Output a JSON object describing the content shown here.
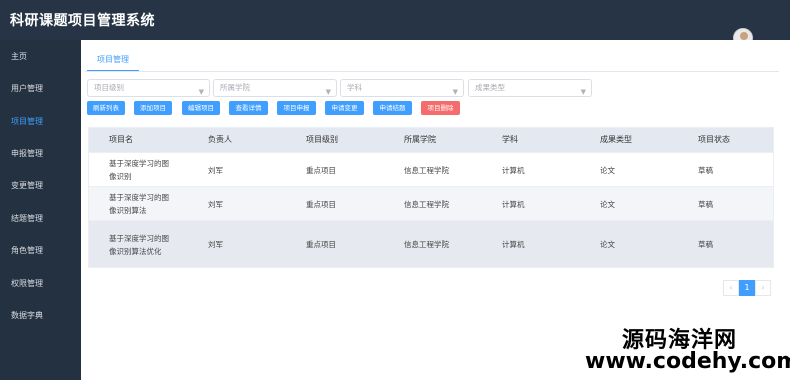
{
  "app": {
    "title": "科研课题项目管理系统"
  },
  "sidebar": {
    "items": [
      {
        "label": "主页",
        "active": false
      },
      {
        "label": "用户管理",
        "active": false
      },
      {
        "label": "项目管理",
        "active": true
      },
      {
        "label": "申报管理",
        "active": false
      },
      {
        "label": "变更管理",
        "active": false
      },
      {
        "label": "结题管理",
        "active": false
      },
      {
        "label": "角色管理",
        "active": false
      },
      {
        "label": "权限管理",
        "active": false
      },
      {
        "label": "数据字典",
        "active": false
      }
    ]
  },
  "tabs": [
    {
      "label": "项目管理"
    }
  ],
  "filters": {
    "level": {
      "placeholder": "项目级别"
    },
    "college": {
      "placeholder": "所属学院"
    },
    "subject": {
      "placeholder": "学科"
    },
    "result_type": {
      "placeholder": "成果类型"
    }
  },
  "toolbar": {
    "refresh": "刷新列表",
    "add": "添加项目",
    "edit": "编辑项目",
    "details": "查看详情",
    "declare": "项目申报",
    "change": "申请变更",
    "conclude": "申请结题",
    "delete": "项目删除"
  },
  "table": {
    "headers": [
      "项目名",
      "负责人",
      "项目级别",
      "所属学院",
      "学科",
      "成果类型",
      "项目状态"
    ],
    "rows": [
      {
        "name": "基于深度学习的图像识别",
        "owner": "刘军",
        "level": "重点项目",
        "college": "信息工程学院",
        "subject": "计算机",
        "result": "论文",
        "status": "草稿"
      },
      {
        "name": "基于深度学习的图像识别算法",
        "owner": "刘军",
        "level": "重点项目",
        "college": "信息工程学院",
        "subject": "计算机",
        "result": "论文",
        "status": "草稿"
      },
      {
        "name": "基于深度学习的图像识别算法优化",
        "owner": "刘军",
        "level": "重点项目",
        "college": "信息工程学院",
        "subject": "计算机",
        "result": "论文",
        "status": "草稿"
      }
    ]
  },
  "pagination": {
    "prev": "‹",
    "current": "1",
    "next": "›"
  },
  "watermark": {
    "line1": "源码海洋网",
    "line2": "www.codehy.com"
  },
  "colors": {
    "primary": "#409eff",
    "danger": "#f56c6c",
    "sidebar": "#243140",
    "topbar": "#263445"
  }
}
